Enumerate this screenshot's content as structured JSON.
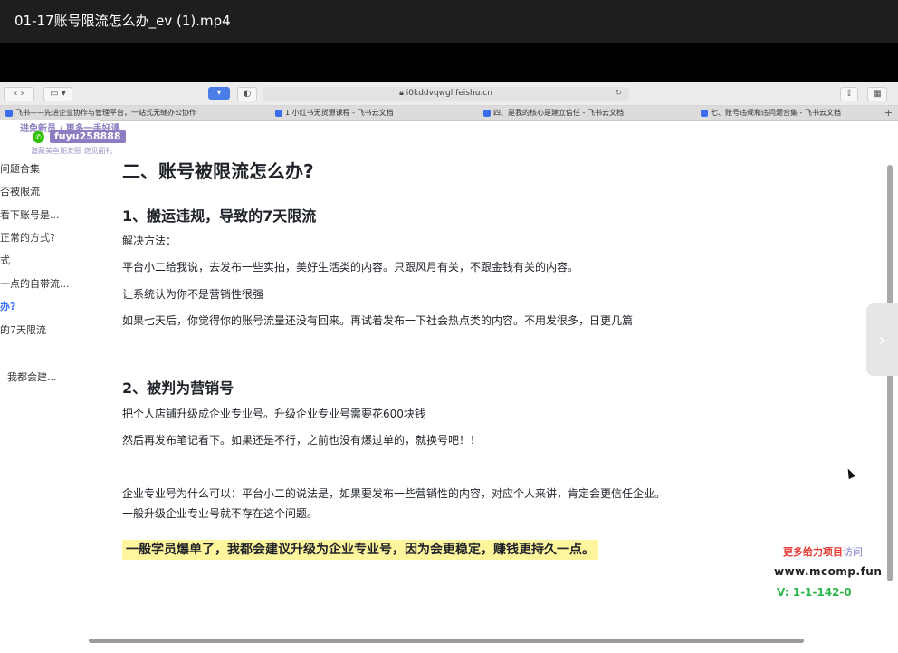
{
  "player": {
    "title": "01-17账号限流怎么办_ev (1).mp4"
  },
  "browser": {
    "url": "i0kddvqwgl.feishu.cn",
    "tabs": [
      {
        "label": "飞书——先进企业协作与管理平台，一站式无缝办公协作"
      },
      {
        "label": "1.小红书无货源课程 - 飞书云文档"
      },
      {
        "label": "四、是我的核心是建立信任 - 飞书云文档"
      },
      {
        "label": "七、账号违规和违问题合集 - 飞书云文档"
      }
    ]
  },
  "sidebar": {
    "promo_line1": "进免新员 / 更多一手好课",
    "promo_id": "fuyu258888",
    "promo_line2": "潜藏美鱼朋友圈 送见面礼",
    "items": [
      {
        "label": "问题合集"
      },
      {
        "label": "否被限流"
      },
      {
        "label": "看下账号是..."
      },
      {
        "label": "正常的方式?"
      },
      {
        "label": "式"
      },
      {
        "label": "一点的自带流..."
      },
      {
        "label": "办?"
      },
      {
        "label": "的7天限流"
      },
      {
        "label": "我都会建..."
      }
    ]
  },
  "content": {
    "h1": "二、账号被限流怎么办?",
    "s1_title": "1、搬运违规，导致的7天限流",
    "s1_p1": "解决方法：",
    "s1_p2": "平台小二给我说，去发布一些实拍，美好生活类的内容。只跟风月有关，不跟金钱有关的内容。",
    "s1_p3": "让系统认为你不是营销性很强",
    "s1_p4": "如果七天后，你觉得你的账号流量还没有回来。再试着发布一下社会热点类的内容。不用发很多，日更几篇",
    "s2_title": "2、被判为营销号",
    "s2_p1": "把个人店铺升级成企业专业号。升级企业专业号需要花600块钱",
    "s2_p2": "然后再发布笔记看下。如果还是不行，之前也没有爆过单的，就换号吧！！",
    "s2_p3": "企业专业号为什么可以：平台小二的说法是，如果要发布一些营销性的内容，对应个人来讲，肯定会更信任企业。",
    "s2_p4": "一般升级企业专业号就不存在这个问题。",
    "highlight": "一般学员爆单了，我都会建议升级为企业专业号，因为会更稳定，赚钱更持久一点。"
  },
  "watermark": {
    "line1": "更多给力项目",
    "line1_suffix": "访问",
    "line2": "www.mcomp.fun",
    "line3": "V: 1-1-142-0"
  }
}
